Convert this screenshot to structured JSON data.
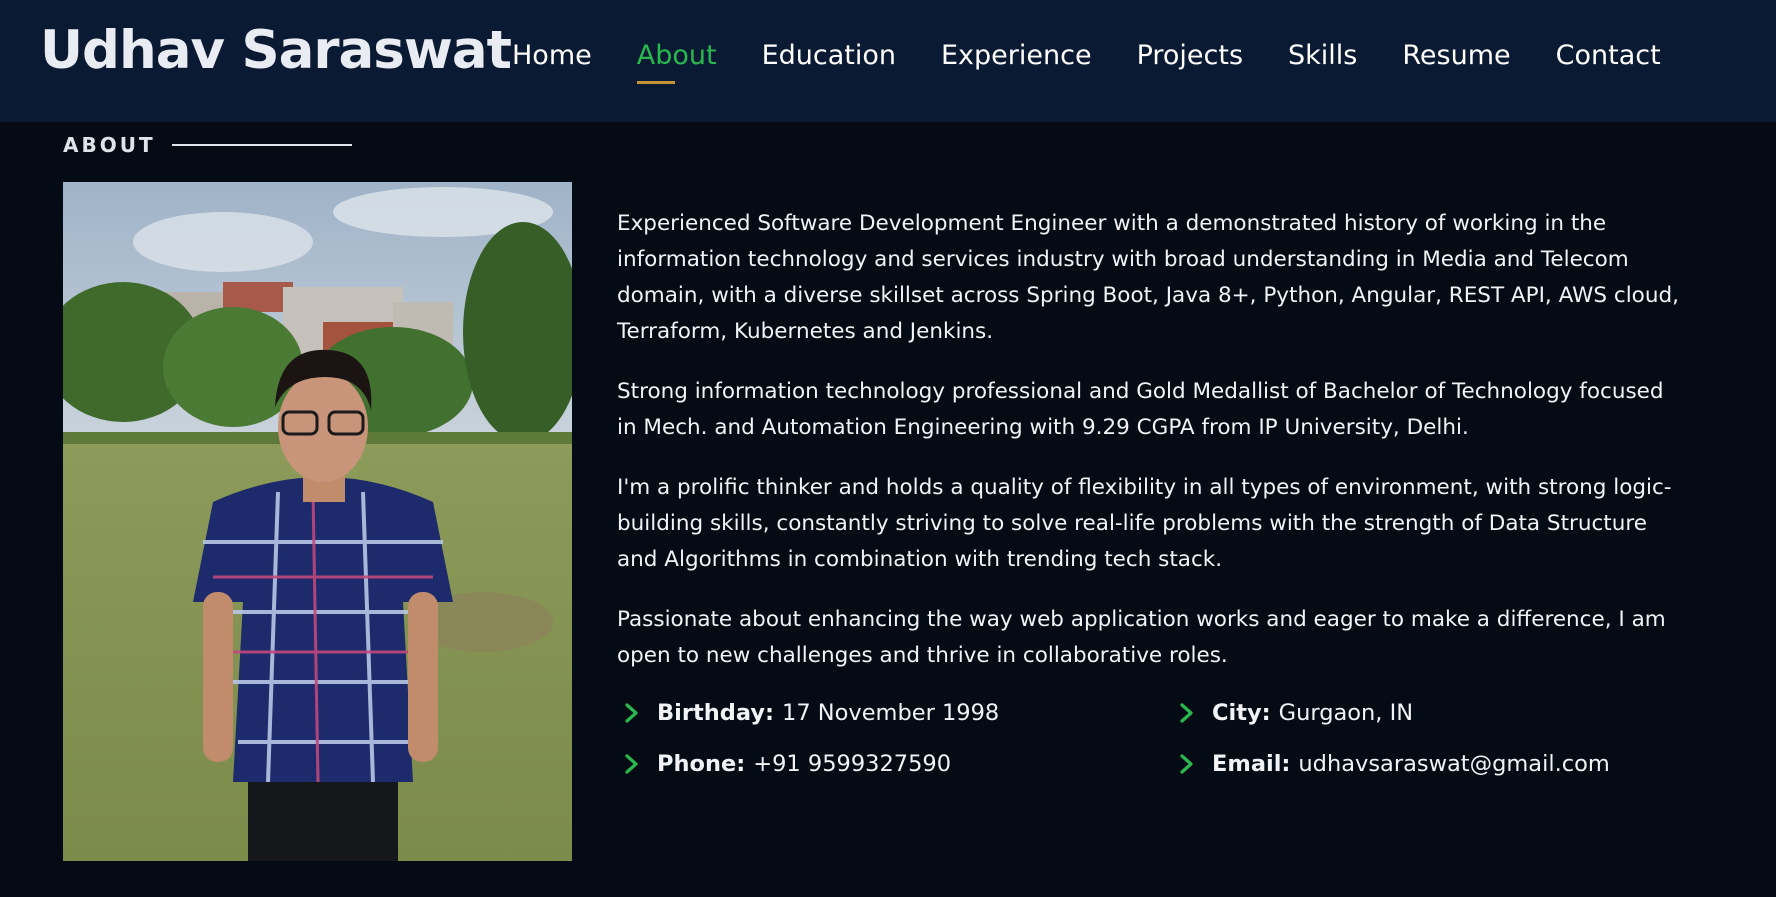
{
  "header": {
    "logo": "Udhav Saraswat",
    "nav": [
      {
        "label": "Home",
        "active": false
      },
      {
        "label": "About",
        "active": true
      },
      {
        "label": "Education",
        "active": false
      },
      {
        "label": "Experience",
        "active": false
      },
      {
        "label": "Projects",
        "active": false
      },
      {
        "label": "Skills",
        "active": false
      },
      {
        "label": "Resume",
        "active": false
      },
      {
        "label": "Contact",
        "active": false
      }
    ]
  },
  "about": {
    "section_title": "ABOUT",
    "paragraphs": [
      "Experienced Software Development Engineer with a demonstrated history of working in the information technology and services industry with broad understanding in Media and Telecom domain, with a diverse skillset across Spring Boot, Java 8+, Python, Angular, REST API, AWS cloud, Terraform, Kubernetes and Jenkins.",
      "Strong information technology professional and Gold Medallist of Bachelor of Technology focused in Mech. and Automation Engineering with 9.29 CGPA from IP University, Delhi.",
      "I'm a prolific thinker and holds a quality of flexibility in all types of environment, with strong logic-building skills, constantly striving to solve real-life problems with the strength of Data Structure and Algorithms in combination with trending tech stack.",
      "Passionate about enhancing the way web application works and eager to make a difference, I am open to new challenges and thrive in collaborative roles."
    ],
    "details": {
      "birthday": {
        "label": "Birthday:",
        "value": "17 November 1998"
      },
      "city": {
        "label": "City:",
        "value": "Gurgaon, IN"
      },
      "phone": {
        "label": "Phone:",
        "value": "+91 9599327590"
      },
      "email": {
        "label": "Email:",
        "value": "udhavsaraswat@gmail.com"
      }
    }
  },
  "colors": {
    "header_bg": "#0a1a32",
    "page_bg": "#040b14",
    "accent_green": "#28b84f",
    "underline_gold": "#c39532"
  }
}
